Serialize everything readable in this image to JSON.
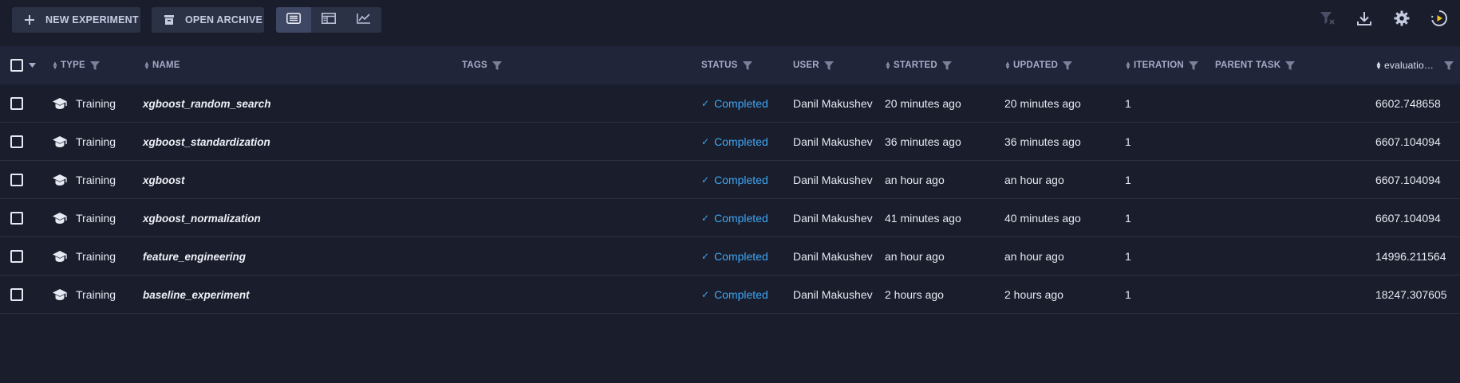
{
  "toolbar": {
    "new_experiment_label": "NEW EXPERIMENT",
    "open_archive_label": "OPEN ARCHIVE"
  },
  "table": {
    "headers": {
      "type": "TYPE",
      "name": "NAME",
      "tags": "TAGS",
      "status": "STATUS",
      "user": "USER",
      "started": "STARTED",
      "updated": "UPDATED",
      "iteration": "ITERATION",
      "parent_task": "PARENT TASK",
      "evaluation": "evaluatio…"
    },
    "rows": [
      {
        "type": "Training",
        "name": "xgboost_random_search",
        "status": "Completed",
        "user": "Danil Makushev",
        "started": "20 minutes ago",
        "updated": "20 minutes ago",
        "iteration": "1",
        "evaluation": "6602.748658"
      },
      {
        "type": "Training",
        "name": "xgboost_standardization",
        "status": "Completed",
        "user": "Danil Makushev",
        "started": "36 minutes ago",
        "updated": "36 minutes ago",
        "iteration": "1",
        "evaluation": "6607.104094"
      },
      {
        "type": "Training",
        "name": "xgboost",
        "status": "Completed",
        "user": "Danil Makushev",
        "started": "an hour ago",
        "updated": "an hour ago",
        "iteration": "1",
        "evaluation": "6607.104094"
      },
      {
        "type": "Training",
        "name": "xgboost_normalization",
        "status": "Completed",
        "user": "Danil Makushev",
        "started": "41 minutes ago",
        "updated": "40 minutes ago",
        "iteration": "1",
        "evaluation": "6607.104094"
      },
      {
        "type": "Training",
        "name": "feature_engineering",
        "status": "Completed",
        "user": "Danil Makushev",
        "started": "an hour ago",
        "updated": "an hour ago",
        "iteration": "1",
        "evaluation": "14996.211564"
      },
      {
        "type": "Training",
        "name": "baseline_experiment",
        "status": "Completed",
        "user": "Danil Makushev",
        "started": "2 hours ago",
        "updated": "2 hours ago",
        "iteration": "1",
        "evaluation": "18247.307605"
      }
    ]
  },
  "colors": {
    "background": "#1a1d2b",
    "header_background": "#21253a",
    "button_background": "#2c3246",
    "status_completed": "#3ea7f5",
    "accent_yellow": "#f0c419"
  },
  "icons": {
    "new_experiment": "plus-icon",
    "open_archive": "archive-icon",
    "view_table": "table-view-icon",
    "view_details": "details-view-icon",
    "view_compare": "chart-view-icon",
    "clear_filters": "clear-filter-icon",
    "download": "download-icon",
    "settings": "gear-icon",
    "auto_refresh": "auto-refresh-icon",
    "row_type": "graduation-cap-icon",
    "status_completed": "check-icon"
  }
}
